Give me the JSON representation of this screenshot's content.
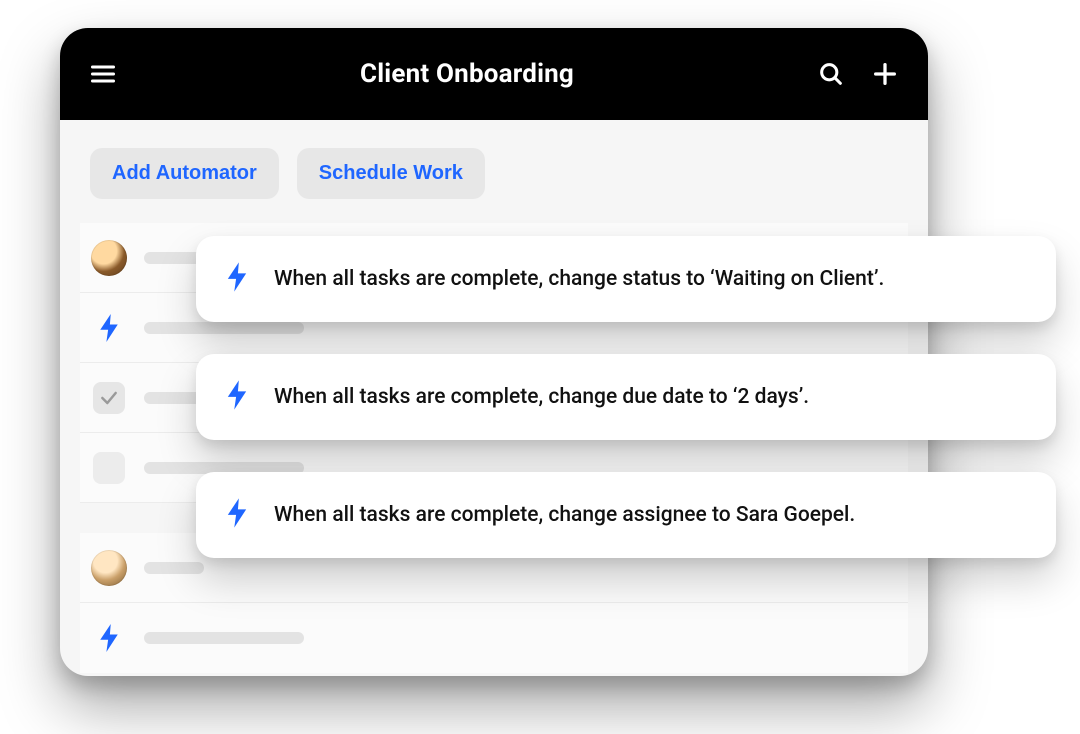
{
  "header": {
    "title": "Client Onboarding"
  },
  "toolbar": {
    "add_automator_label": "Add Automator",
    "schedule_work_label": "Schedule Work"
  },
  "automator_cards": [
    {
      "text": "When all tasks are complete, change status to ‘Waiting on Client’."
    },
    {
      "text": "When all tasks are complete, change due date to ‘2 days’."
    },
    {
      "text": "When all tasks are complete, change assignee to Sara Goepel."
    }
  ]
}
